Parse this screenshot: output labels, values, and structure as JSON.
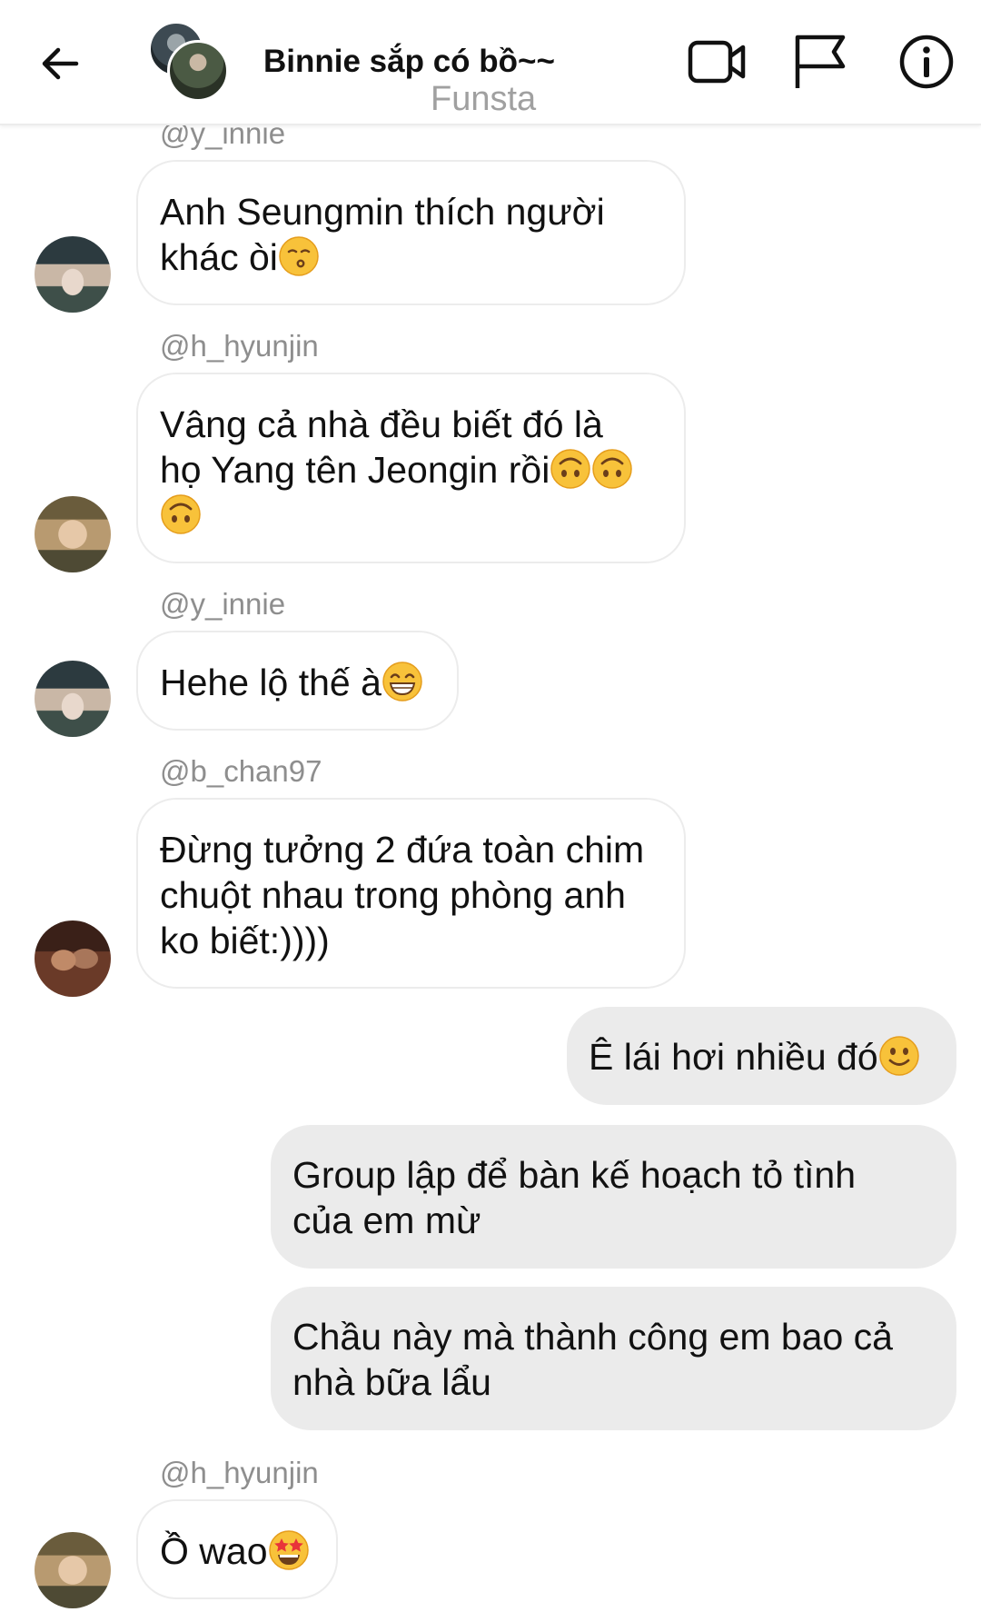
{
  "header": {
    "title": "Binnie sắp có bồ~~",
    "subtitle": "Funsta",
    "icons": [
      "back-arrow-icon",
      "video-call-icon",
      "flag-icon",
      "info-icon"
    ]
  },
  "messages": [
    {
      "sender": "@y_innie",
      "text_lines": [
        "Anh Seungmin thích người",
        "khác òi"
      ],
      "emoji_tail": [
        "kissing-face"
      ]
    },
    {
      "sender": "@h_hyunjin",
      "text_lines": [
        "Vâng cả nhà đều biết đó là",
        "họ Yang tên Jeongin rồi"
      ],
      "emoji_tail": [
        "upside-down-face",
        "upside-down-face",
        "upside-down-face"
      ]
    },
    {
      "sender": "@y_innie",
      "text_lines": [
        "Hehe lộ thế à"
      ],
      "emoji_tail": [
        "grinning-face"
      ]
    },
    {
      "sender": "@b_chan97",
      "text_lines": [
        "Đừng tưởng 2 đứa toàn chim",
        "chuột nhau trong phòng anh",
        "ko biết:))))"
      ],
      "emoji_tail": []
    },
    {
      "sender": "me",
      "text_lines": [
        "Ê lái hơi nhiều đó"
      ],
      "emoji_tail": [
        "slightly-smiling-face"
      ]
    },
    {
      "sender": "me",
      "text_lines": [
        "Group lập để bàn kế hoạch tỏ tình",
        "của em mừ"
      ],
      "emoji_tail": []
    },
    {
      "sender": "me",
      "text_lines": [
        "Chầu này mà thành công em bao cả",
        "nhà bữa lẩu"
      ],
      "emoji_tail": []
    },
    {
      "sender": "@h_hyunjin",
      "text_lines": [
        "Ồ wao"
      ],
      "emoji_tail": [
        "star-struck-face"
      ]
    }
  ]
}
